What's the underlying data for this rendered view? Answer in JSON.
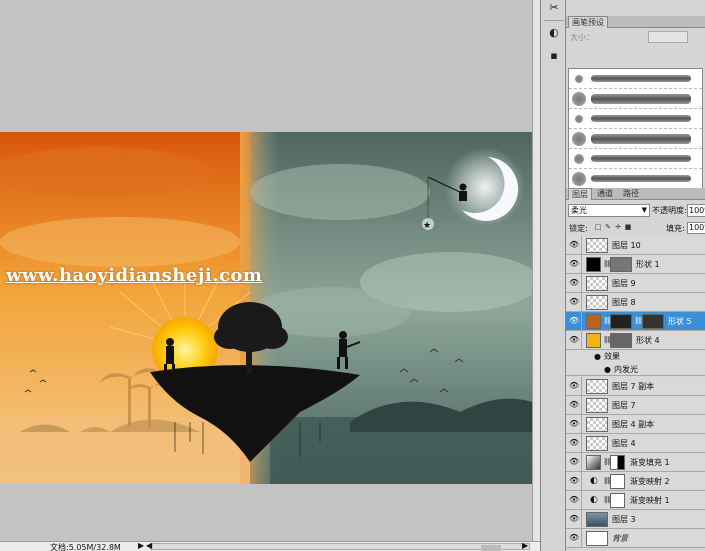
{
  "canvas": {
    "watermark": "www.haoyidiansheji.com"
  },
  "status_bar": {
    "doc_info": "文档:5.05M/32.8M"
  },
  "brush_panel": {
    "tabs": [
      "画笔预设"
    ],
    "size_label": "大小："
  },
  "layers_panel": {
    "tabs": [
      "图层",
      "通道",
      "路径"
    ],
    "blend_mode": "柔光",
    "opacity_label": "不透明度:",
    "opacity_value": "100%",
    "lock_label": "锁定:",
    "fill_label": "填充:",
    "fill_value": "100%",
    "effects_label": "效果",
    "inner_glow_label": "内发光",
    "layers": [
      {
        "name": "图层 10",
        "thumb": "checker"
      },
      {
        "name": "形状 1",
        "thumb": "shape-black"
      },
      {
        "name": "图层 9",
        "thumb": "checker"
      },
      {
        "name": "图层 8",
        "thumb": "checker"
      },
      {
        "name": "形状 5",
        "thumb": "shape-orange",
        "selected": true
      },
      {
        "name": "形状 4",
        "thumb": "shape-yellow"
      },
      {
        "name": "图层 7 副本",
        "thumb": "checker"
      },
      {
        "name": "图层 7",
        "thumb": "checker"
      },
      {
        "name": "图层 4 副本",
        "thumb": "checker"
      },
      {
        "name": "图层 4",
        "thumb": "checker"
      },
      {
        "name": "渐变填充 1",
        "thumb": "gradient"
      },
      {
        "name": "渐变映射 2",
        "thumb": "adjust"
      },
      {
        "name": "渐变映射 1",
        "thumb": "adjust"
      },
      {
        "name": "图层 3",
        "thumb": "photo"
      },
      {
        "name": "背景",
        "thumb": "white"
      }
    ]
  },
  "colors": {
    "selected_layer": "#3a8fd9",
    "panel_bg": "#d6d6d6",
    "canvas_bg": "#c3c3c3"
  }
}
